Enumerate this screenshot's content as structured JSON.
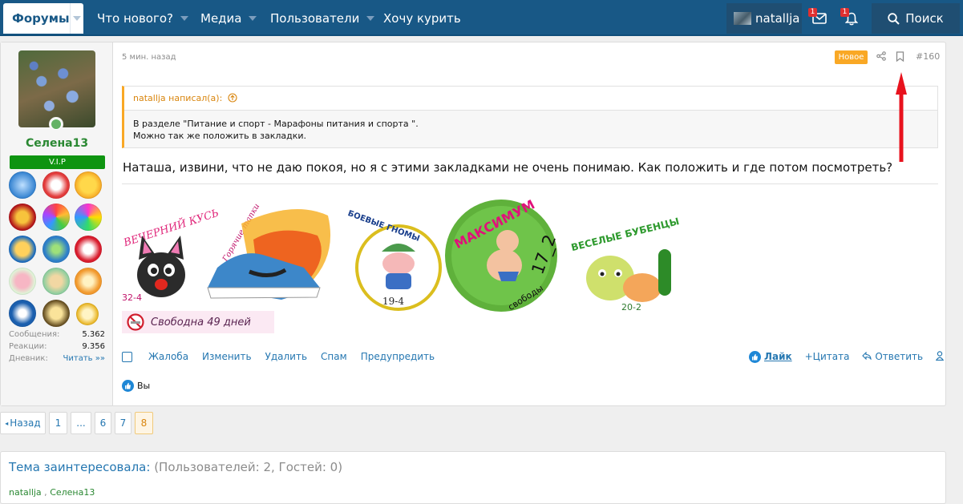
{
  "nav": {
    "forums": "Форумы",
    "items": [
      "Что нового?",
      "Медиа",
      "Пользователи",
      "Хочу курить"
    ],
    "username": "natallja",
    "inbox_badge": "1",
    "alerts_badge": "1",
    "search": "Поиск"
  },
  "post": {
    "author": "Селена13",
    "banner": "V.I.P",
    "stats": [
      {
        "label": "Сообщения:",
        "value": "5.362"
      },
      {
        "label": "Реакции:",
        "value": "9.356"
      },
      {
        "label": "Дневник:",
        "value": "Читать »»"
      }
    ],
    "time": "5 мин. назад",
    "new_badge": "Новое",
    "number": "#160",
    "quote": {
      "header": "natallja написал(а):",
      "line1": "В разделе \"Питание и спорт - Марафоны питания и спорта \".",
      "line2": "Можно так же положить в закладки."
    },
    "text": "Наташа, извини, что не даю покоя, но я с этими закладками не очень понимаю. Как положить и где потом посмотреть?",
    "signature": {
      "b1_title": "ВЕЧЕРНИЙ КУСЬ",
      "b1_num": "32-4",
      "b2_title": "Горячие тапки",
      "b3_title": "БОЕВЫЕ ГНОМЫ",
      "b3_num": "19-4",
      "b4_title": "МАКСИМУМ",
      "b4_num": "17_2",
      "b4_sub": "свободы",
      "b5_title": "ВЕСЕЛЫЕ БУБЕНЦЫ",
      "b5_num": "20-2",
      "free_text": "Свободна 49 дней"
    },
    "actions": [
      "Жалоба",
      "Изменить",
      "Удалить",
      "Спам",
      "Предупредить"
    ],
    "like": "Лайк",
    "quote_btn": "+Цитата",
    "reply": "Ответить",
    "likes_by": "Вы"
  },
  "pagination": {
    "prev": "Назад",
    "pages": [
      "1",
      "...",
      "6",
      "7",
      "8"
    ],
    "current": "8"
  },
  "interested": {
    "title": "Тема заинтересовала:",
    "counts": "(Пользователей: 2, Гостей: 0)",
    "user1": "natallja",
    "sep": " , ",
    "user2": "Селена13"
  },
  "colors": {
    "nav_bg": "#185886",
    "link": "#2577b1",
    "username_green": "#2a8832",
    "new_badge": "#f9a825",
    "vip_green": "#0e9410",
    "arrow_red": "#e8121d"
  }
}
